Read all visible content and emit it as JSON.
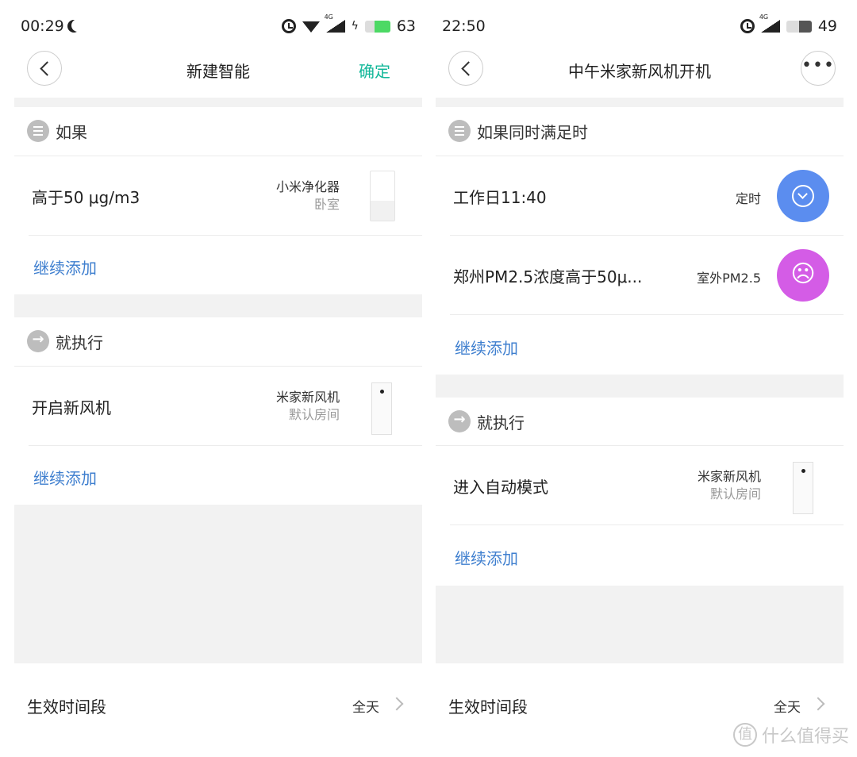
{
  "left": {
    "status": {
      "time": "00:29",
      "signal_label": "4G",
      "battery": "63",
      "battery_level": 0.63,
      "battery_color": "#4cd964"
    },
    "nav": {
      "title": "新建智能",
      "confirm": "确定"
    },
    "if_section": {
      "title": "如果",
      "item": {
        "label": "高于50 μg/m3",
        "device": "小米净化器",
        "room": "卧室"
      },
      "add": "继续添加"
    },
    "then_section": {
      "title": "就执行",
      "item": {
        "label": "开启新风机",
        "device": "米家新风机",
        "room": "默认房间"
      },
      "add": "继续添加"
    },
    "footer": {
      "label": "生效时间段",
      "value": "全天"
    }
  },
  "right": {
    "status": {
      "time": "22:50",
      "signal_label": "4G",
      "battery": "49",
      "battery_level": 0.49,
      "battery_color": "#555555"
    },
    "nav": {
      "title": "中午米家新风机开机"
    },
    "if_section": {
      "title": "如果同时满足时",
      "items": [
        {
          "label": "工作日11:40",
          "device": "定时",
          "icon": "clock-icon",
          "color": "#5b8def"
        },
        {
          "label": "郑州PM2.5浓度高于50μ...",
          "device": "室外PM2.5",
          "icon": "pm25-icon",
          "color": "#d45ce6"
        }
      ],
      "add": "继续添加"
    },
    "then_section": {
      "title": "就执行",
      "item": {
        "label": "进入自动模式",
        "device": "米家新风机",
        "room": "默认房间"
      },
      "add": "继续添加"
    },
    "footer": {
      "label": "生效时间段",
      "value": "全天"
    }
  },
  "watermark": {
    "logo": "值",
    "text": "什么值得买"
  }
}
